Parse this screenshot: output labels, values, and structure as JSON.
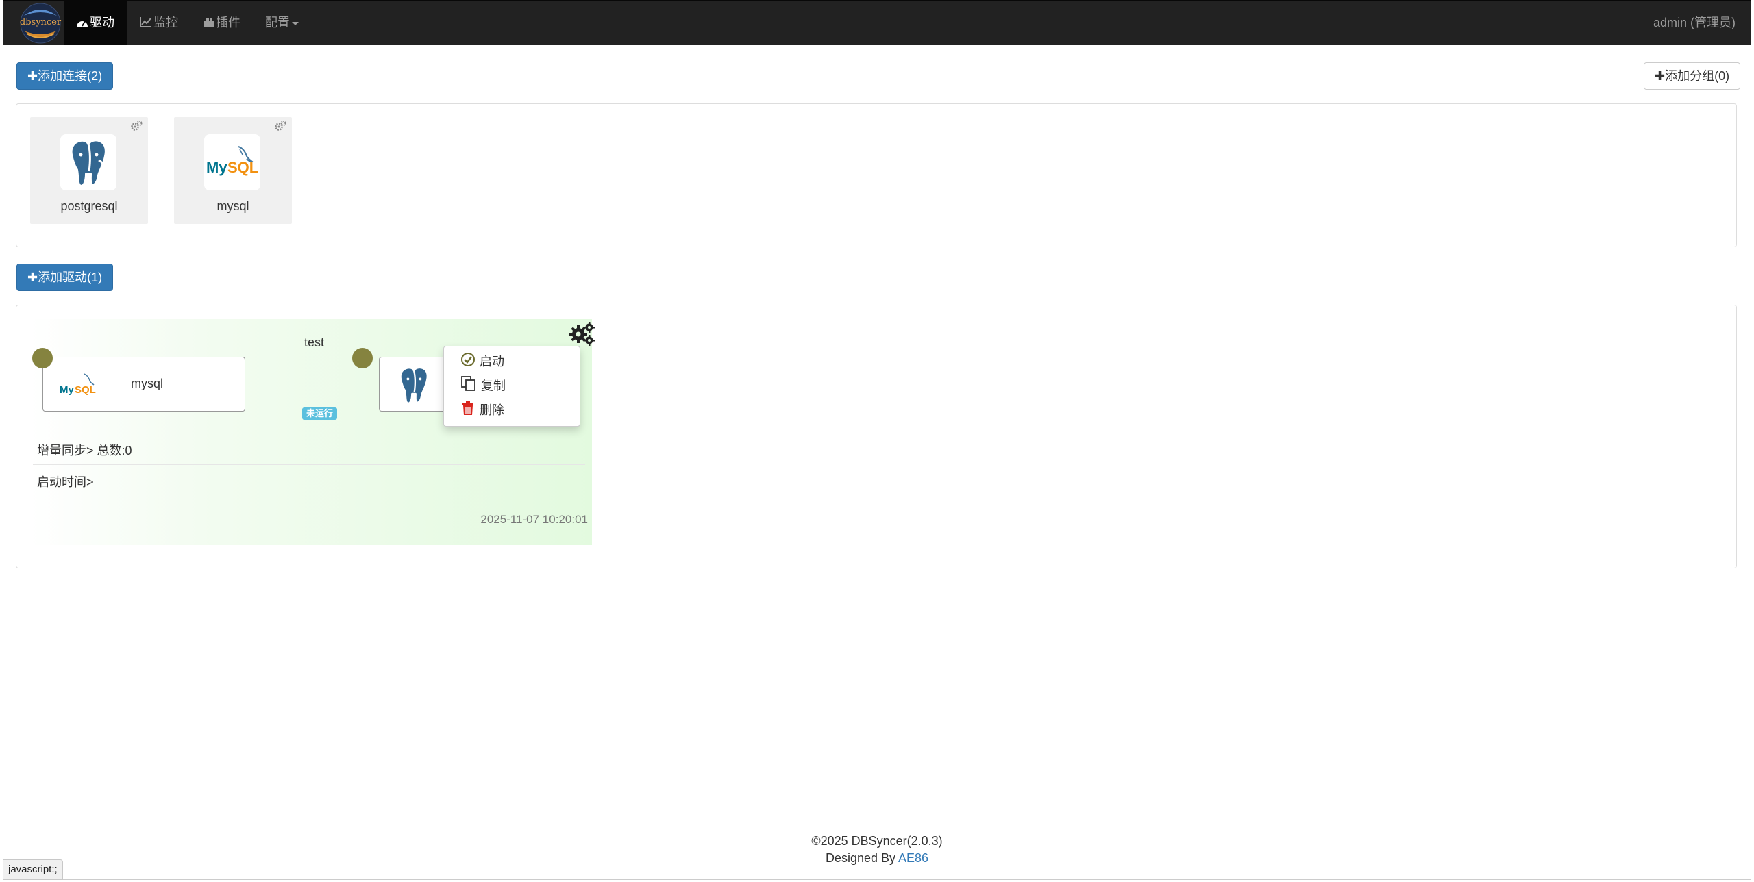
{
  "navbar": {
    "brand_text": "dbsyncer",
    "items": [
      {
        "label": "驱动",
        "icon": "dashboard-icon",
        "active": true
      },
      {
        "label": "监控",
        "icon": "line-chart-icon",
        "active": false
      },
      {
        "label": "插件",
        "icon": "plugin-icon",
        "active": false
      },
      {
        "label": "配置",
        "icon": "",
        "active": false
      }
    ],
    "user": "admin (管理员)"
  },
  "connections": {
    "add_button": "添加连接(2)",
    "add_group_button": "添加分组(0)",
    "items": [
      {
        "name": "postgresql",
        "icon": "postgresql-logo-icon"
      },
      {
        "name": "mysql",
        "icon": "mysql-logo-icon"
      }
    ]
  },
  "drivers": {
    "add_button": "添加驱动(1)",
    "items": [
      {
        "name": "test",
        "source": {
          "name": "mysql",
          "icon": "mysql-logo-icon"
        },
        "target": {
          "icon": "postgresql-logo-icon"
        },
        "status": "未运行",
        "sync_info": "增量同步> 总数:0",
        "start_time": "启动时间>",
        "updated": "2025-11-07 10:20:01"
      }
    ]
  },
  "context_menu": {
    "items": [
      {
        "label": "启动",
        "icon": "check-circle-icon"
      },
      {
        "label": "复制",
        "icon": "copy-icon"
      },
      {
        "label": "删除",
        "icon": "trash-icon"
      }
    ]
  },
  "footer": {
    "copyright": "©2025 DBSyncer(2.0.3)",
    "designed_by": "Designed By ",
    "author": "AE86"
  },
  "statusbar": {
    "text": "javascript:;"
  },
  "colors": {
    "navbar_bg": "#222222",
    "primary": "#337ab7",
    "node_dot": "#85833f",
    "status_badge": "#5bc0de",
    "delete_red": "#d9251d"
  }
}
